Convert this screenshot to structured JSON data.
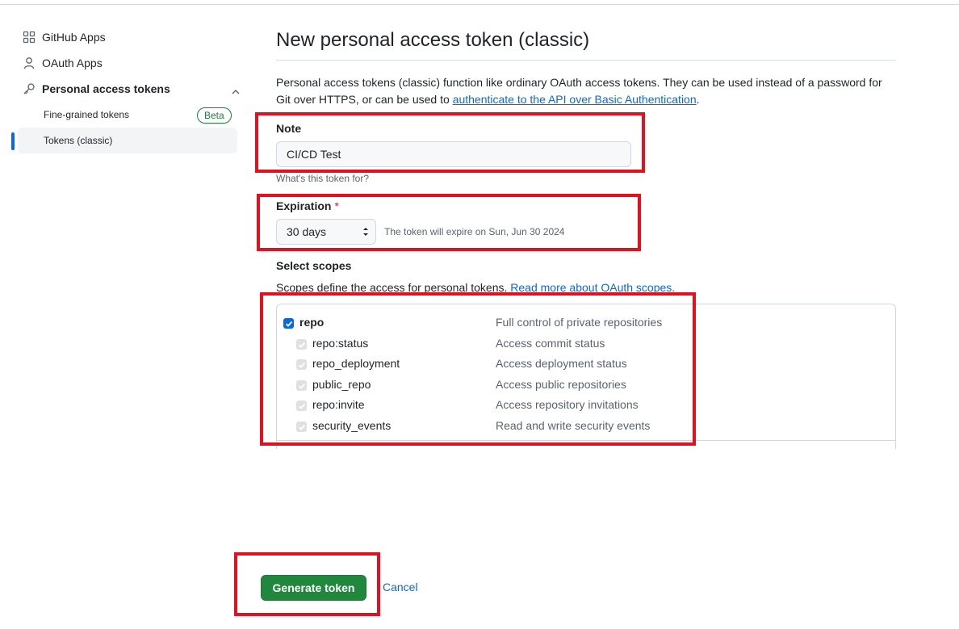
{
  "sidebar": {
    "items": [
      {
        "label": "GitHub Apps",
        "icon": "apps-grid-icon"
      },
      {
        "label": "OAuth Apps",
        "icon": "person-icon"
      },
      {
        "label": "Personal access tokens",
        "icon": "key-icon"
      }
    ],
    "subitems": [
      {
        "label": "Fine-grained tokens",
        "badge": "Beta"
      },
      {
        "label": "Tokens (classic)",
        "active": true
      }
    ]
  },
  "main": {
    "title": "New personal access token (classic)",
    "description_prefix": "Personal access tokens (classic) function like ordinary OAuth access tokens. They can be used instead of a password for Git over HTTPS, or can be used to ",
    "description_link": "authenticate to the API over Basic Authentication",
    "description_suffix": ".",
    "note": {
      "label": "Note",
      "value": "CI/CD Test",
      "hint": "What's this token for?"
    },
    "expiration": {
      "label": "Expiration",
      "required_mark": "*",
      "selected": "30 days",
      "note": "The token will expire on Sun, Jun 30 2024"
    },
    "scopes": {
      "label": "Select scopes",
      "desc_prefix": "Scopes define the access for personal tokens. ",
      "desc_link": "Read more about OAuth scopes.",
      "items": [
        {
          "name": "repo",
          "desc": "Full control of private repositories",
          "checked": true,
          "level": 0
        },
        {
          "name": "repo:status",
          "desc": "Access commit status",
          "checked": true,
          "level": 1
        },
        {
          "name": "repo_deployment",
          "desc": "Access deployment status",
          "checked": true,
          "level": 1
        },
        {
          "name": "public_repo",
          "desc": "Access public repositories",
          "checked": true,
          "level": 1
        },
        {
          "name": "repo:invite",
          "desc": "Access repository invitations",
          "checked": true,
          "level": 1
        },
        {
          "name": "security_events",
          "desc": "Read and write security events",
          "checked": true,
          "level": 1
        }
      ]
    },
    "actions": {
      "generate": "Generate token",
      "cancel": "Cancel"
    }
  },
  "colors": {
    "accent": "#0969da",
    "primary_button": "#1f883d",
    "highlight": "#e3111f",
    "beta": "#1a7f37"
  }
}
